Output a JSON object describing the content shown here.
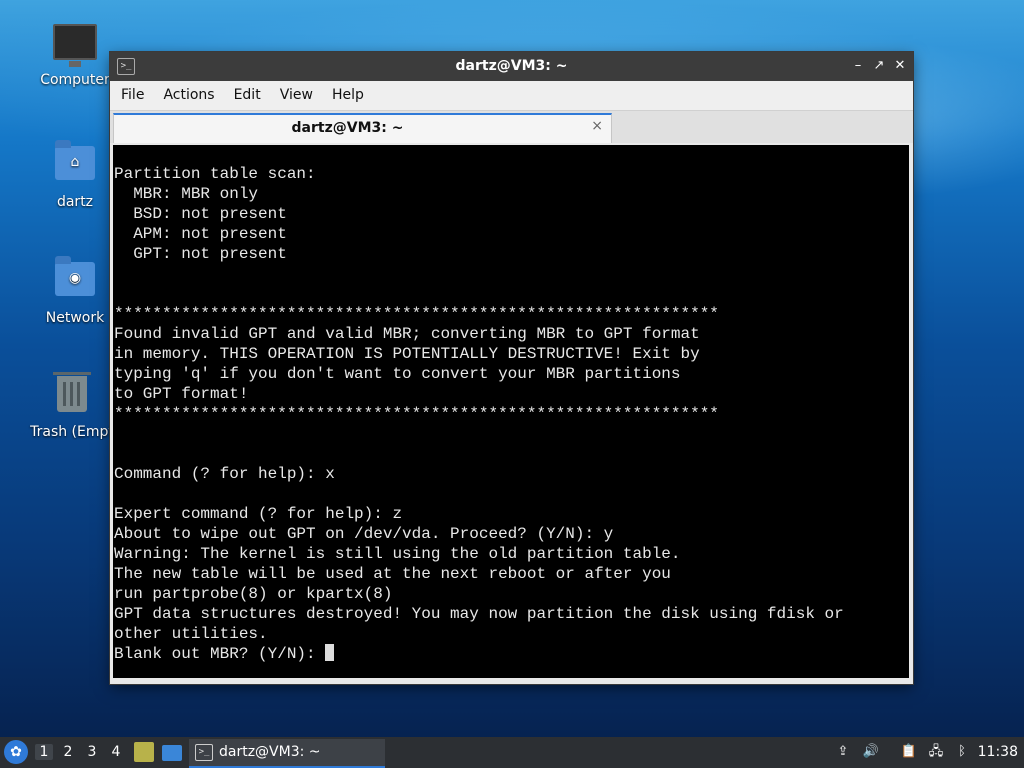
{
  "desktop": {
    "icons": [
      {
        "label": "Computer",
        "icon": "computer-icon"
      },
      {
        "label": "dartz",
        "icon": "home-folder-icon"
      },
      {
        "label": "Network",
        "icon": "network-folder-icon"
      },
      {
        "label": "Trash (Empt",
        "icon": "trash-icon"
      }
    ]
  },
  "window": {
    "title": "dartz@VM3: ~",
    "menu": [
      "File",
      "Actions",
      "Edit",
      "View",
      "Help"
    ],
    "tab": {
      "label": "dartz@VM3: ~",
      "close": "×"
    },
    "controls": {
      "minimize": "–",
      "maximize": "↗",
      "close": "✕"
    }
  },
  "terminal": {
    "lines": [
      "Partition table scan:",
      "  MBR: MBR only",
      "  BSD: not present",
      "  APM: not present",
      "  GPT: not present",
      "",
      "",
      "***************************************************************",
      "Found invalid GPT and valid MBR; converting MBR to GPT format",
      "in memory. THIS OPERATION IS POTENTIALLY DESTRUCTIVE! Exit by",
      "typing 'q' if you don't want to convert your MBR partitions",
      "to GPT format!",
      "***************************************************************",
      "",
      "",
      "Command (? for help): x",
      "",
      "Expert command (? for help): z",
      "About to wipe out GPT on /dev/vda. Proceed? (Y/N): y",
      "Warning: The kernel is still using the old partition table.",
      "The new table will be used at the next reboot or after you",
      "run partprobe(8) or kpartx(8)",
      "GPT data structures destroyed! You may now partition the disk using fdisk or",
      "other utilities."
    ],
    "prompt": "Blank out MBR? (Y/N): "
  },
  "taskbar": {
    "workspaces": [
      "1",
      "2",
      "3",
      "4"
    ],
    "active_workspace": "1",
    "task_label": "dartz@VM3: ~",
    "clock": "11:38"
  },
  "colors": {
    "accent": "#2f7ad8",
    "terminal_bg": "#000000",
    "titlebar": "#3c3c3c"
  }
}
